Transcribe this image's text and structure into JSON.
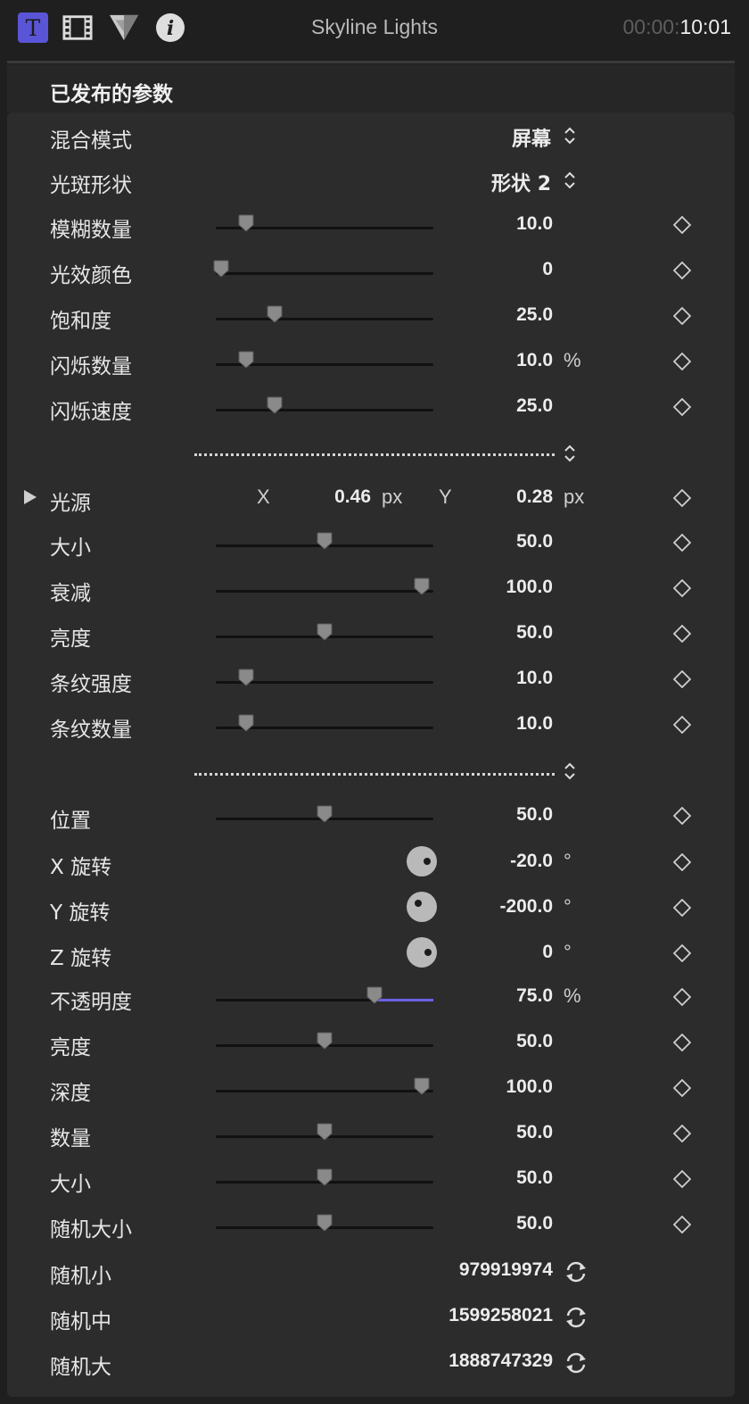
{
  "toolbar": {
    "title": "Skyline Lights",
    "timecode_dim": "00:00:",
    "timecode_bright": "10:01",
    "icons": [
      "text-inspector-icon",
      "video-inspector-icon",
      "color-inspector-icon",
      "info-inspector-icon"
    ],
    "accent": "#5a55d6"
  },
  "section": {
    "title": "已发布的参数"
  },
  "rows": {
    "blend_mode": {
      "label": "混合模式",
      "value": "屏幕"
    },
    "flare_shape": {
      "label": "光斑形状",
      "value": "形状 2"
    },
    "blur_amount": {
      "label": "模糊数量",
      "value": "10.0",
      "level": 0.12
    },
    "glow_color": {
      "label": "光效颜色",
      "value": "0",
      "level": 0.0
    },
    "saturation": {
      "label": "饱和度",
      "value": "25.0",
      "level": 0.26
    },
    "flicker_amount": {
      "label": "闪烁数量",
      "value": "10.0",
      "unit": "%",
      "level": 0.12
    },
    "flicker_speed": {
      "label": "闪烁速度",
      "value": "25.0",
      "level": 0.26
    },
    "light_source": {
      "label": "光源",
      "x_label": "X",
      "x_value": "0.46",
      "x_unit": "px",
      "y_label": "Y",
      "y_value": "0.28",
      "y_unit": "px"
    },
    "size1": {
      "label": "大小",
      "value": "50.0",
      "level": 0.5
    },
    "falloff": {
      "label": "衰减",
      "value": "100.0",
      "level": 0.97
    },
    "brightness1": {
      "label": "亮度",
      "value": "50.0",
      "level": 0.5
    },
    "streak_intensity": {
      "label": "条纹强度",
      "value": "10.0",
      "level": 0.12
    },
    "streak_count": {
      "label": "条纹数量",
      "value": "10.0",
      "level": 0.12
    },
    "position": {
      "label": "位置",
      "value": "50.0",
      "level": 0.5
    },
    "x_rotation": {
      "label": "X 旋转",
      "value": "-20.0",
      "unit": "°"
    },
    "y_rotation": {
      "label": "Y 旋转",
      "value": "-200.0",
      "unit": "°"
    },
    "z_rotation": {
      "label": "Z 旋转",
      "value": "0",
      "unit": "°"
    },
    "opacity": {
      "label": "不透明度",
      "value": "75.0",
      "unit": "%",
      "level": 0.74
    },
    "brightness2": {
      "label": "亮度",
      "value": "50.0",
      "level": 0.5
    },
    "depth": {
      "label": "深度",
      "value": "100.0",
      "level": 0.97
    },
    "count": {
      "label": "数量",
      "value": "50.0",
      "level": 0.5
    },
    "size2": {
      "label": "大小",
      "value": "50.0",
      "level": 0.5
    },
    "random_size": {
      "label": "随机大小",
      "value": "50.0",
      "level": 0.5
    },
    "random_small": {
      "label": "随机小",
      "value": "979919974"
    },
    "random_medium": {
      "label": "随机中",
      "value": "1599258021"
    },
    "random_large": {
      "label": "随机大",
      "value": "1888747329"
    }
  }
}
